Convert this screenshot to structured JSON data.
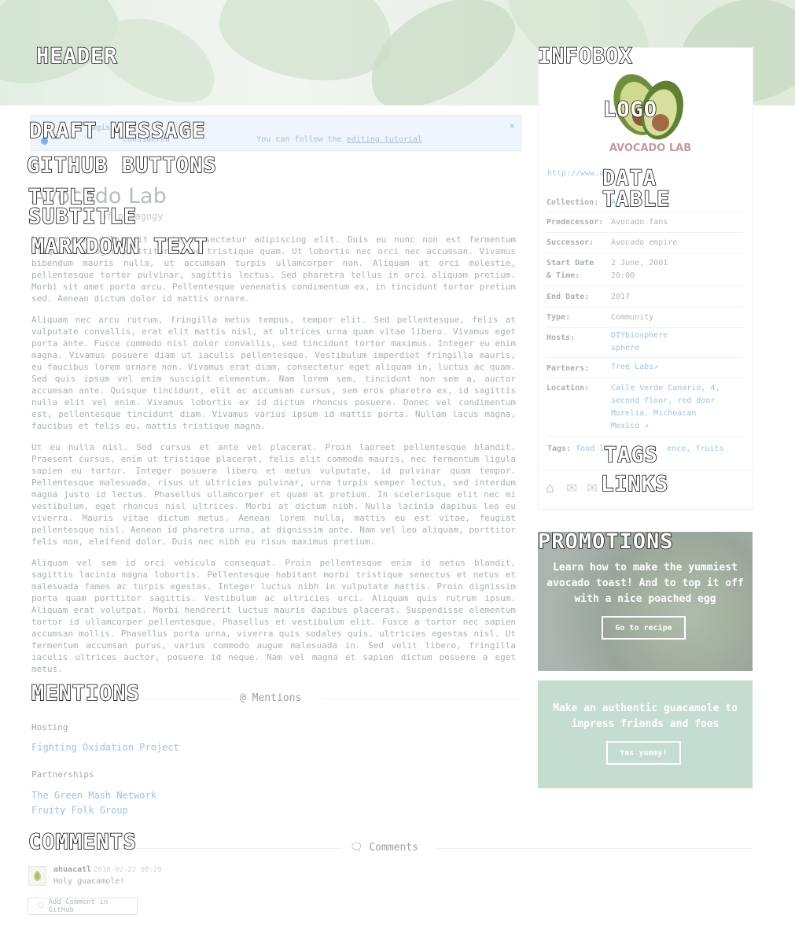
{
  "wireframe_labels": {
    "header": "HEADER",
    "infobox": "INFOBOX",
    "draft_message": "DRAFT MESSAGE",
    "logo": "LOGO",
    "github_buttons": "GITHUB BUTTONS",
    "data_table": "DATA TABLE",
    "title": "TITLE",
    "subtitle": "SUBTITLE",
    "markdown_text": "MARKDOWN TEXT",
    "tags": "TAGS",
    "links": "LINKS",
    "promotions": "PROMOTIONS",
    "mentions": "MENTIONS",
    "comments": "COMMENTS"
  },
  "draft": {
    "title": "ragis",
    "text": "considered",
    "follow_text": "You can follow the",
    "link": "editing tutorial",
    "close": "×"
  },
  "page": {
    "title": "Avocado Lab",
    "subtitle": "of pedagogy"
  },
  "markdown": {
    "paragraphs": [
      "Lorem ipsum dolor sit amet, consectetur adipiscing elit. Duis eu nunc non est fermentum aliquam. Integer porttitor vitae tristique quam. Ut lobortis nec orci nec accumsan. Vivamus bibendum mauris nulla, ut accumsan turpis ullamcorper non. Aliquam at orci molestie, pellentesque tortor pulvinar, sagittis lectus. Sed pharetra tellus in orci aliquam pretium. Morbi sit amet porta arcu. Pellentesque venenatis condimentum ex, in tincidunt tortor pretium sed. Aenean dictum dolor id mattis ornare.",
      "Aliquam nec arcu rutrum, fringilla metus tempus, tempor elit. Sed pellentesque, felis at vulputate convallis, erat elit mattis nisl, at ultrices urna quam vitae libero. Vivamus eget porta ante. Fusce commodo nisl dolor convallis, sed tincidunt tortor maximus. Integer eu enim magna. Vivamus posuere diam ut iaculis pellentesque. Vestibulum imperdiet fringilla mauris, eu faucibus lorem ornare non. Vivamus erat diam, consectetur eget aliquam in, luctus ac quam. Sed quis ipsum vel enim suscipit elementum. Nam lorem sem, tincidunt non sem a, auctor accumsan ante. Quisque tincidunt, elit ac accumsan cursus, sem eros pharetra ex, id sagittis nulla elit vel enim. Vivamus lobortis ex id dictum rhoncus posuere. Donec vel condimentum est, pellentesque tincidunt diam. Vivamus varius ipsum id mattis porta. Nullam lacus magna, faucibus et felis eu, mattis tristique magna.",
      "Ut eu nulla nisl. Sed cursus et ante vel placerat. Proin laoreet pellentesque blandit. Praesent cursus, enim ut tristique placerat, felis elit commodo mauris, nec fermentum ligula sapien eu tortor. Integer posuere libero et metus vulputate, id pulvinar quam tempor. Pellentesque malesuada, risus ut ultricies pulvinar, urna turpis semper lectus, sed interdum magna justo id lectus. Phasellus ullamcorper et quam at pretium. In scelerisque elit nec mi vestibulum, eget rhoncus nisl ultrices. Morbi at dictum nibh. Nulla lacinia dapibus leo eu viverra. Mauris vitae dictum metus. Aenean lorem nulla, mattis eu est vitae, feugiat pellentesque nisl. Aenean id pharetra urna, at dignissim ante. Nam vel leo aliquam, porttitor felis non, eleifend dolor. Duis nec nibh eu risus maximus pretium.",
      "Aliquam vel sem id orci vehicula consequat. Proin pellentesque enim id metus blandit, sagittis lacinia magna lobortis. Pellentesque habitant morbi tristique senectus et netus et malesuada fames ac turpis egestas. Integer luctus nibh in vulputate mattis. Proin dignissim porta quam porttitor sagittis. Vestibulum ac ultricies orci. Aliquam quis rutrum ipsum. Aliquam erat volutpat. Morbi hendrerit luctus mauris dapibus placerat. Suspendisse elementum tortor id ullamcorper pellentesque. Phasellus et vestibulum elit. Fusce a tortor nec sapien accumsan mollis. Phasellus porta urna, viverra quis sodales quis, ultricies egestas nisl. Ut fermentum accumsan purus, varius commodo augue malesuada in. Sed velit libero, fringilla iaculis ultrices auctor, posuere id neque. Nam vel magna et sapien dictum posuere a eget metus."
    ]
  },
  "mentions": {
    "heading": "@ Mentions",
    "hosting_label": "Hosting",
    "hosting_items": [
      "Fighting Oxidation Project"
    ],
    "partnerships_label": "Partnerships",
    "partnership_items": [
      "The Green Mash Network",
      "Fruity Folk Group"
    ]
  },
  "comments": {
    "heading": "Comments",
    "user": "ahuacatl",
    "date": "2018-02-22 08:29",
    "text": "Holy guacamole!",
    "add_button": "Add Comment in GitHub"
  },
  "infobox": {
    "logo_text": "AVOCADO LAB",
    "url": "http://www.av",
    "rows": [
      {
        "key": "Collection:",
        "value": "A",
        "link": true
      },
      {
        "key": "Predecessor:",
        "value": "Avocado fans",
        "link": false
      },
      {
        "key": "Successor:",
        "value": "Avocado empire",
        "link": false
      },
      {
        "key": "Start Date & Time:",
        "value": "2 June, 2001 20:00",
        "link": false
      },
      {
        "key": "End Date:",
        "value": "2017",
        "link": false
      },
      {
        "key": "Type:",
        "value": "Community",
        "link": false
      },
      {
        "key": "Hosts:",
        "value": "DIYbiosphere sphere",
        "link": true
      },
      {
        "key": "Partners:",
        "value": "Tree Labs↗",
        "link": true
      },
      {
        "key": "Location:",
        "value": "Calle Verde Canario, 4, second floor, red door Morelia, Michoacan Mexico ↗",
        "link": true
      }
    ],
    "tags_label": "Tags:",
    "tags": [
      "food la",
      "ence,",
      "fruits"
    ],
    "link_icons": [
      "home-icon",
      "envelope-icon",
      "chat-icon"
    ]
  },
  "promotions": {
    "promo1_text": "Learn how to make the yummiest avocado toast! And to top it off with a nice poached egg",
    "promo1_button": "Go to recipe",
    "promo2_text": "Make an authentic guacamole to impress friends and foes",
    "promo2_button": "Yes yummy!"
  },
  "colors": {
    "accent_link": "#9cc2e6",
    "promo2_bg": "#c5ddd0"
  }
}
